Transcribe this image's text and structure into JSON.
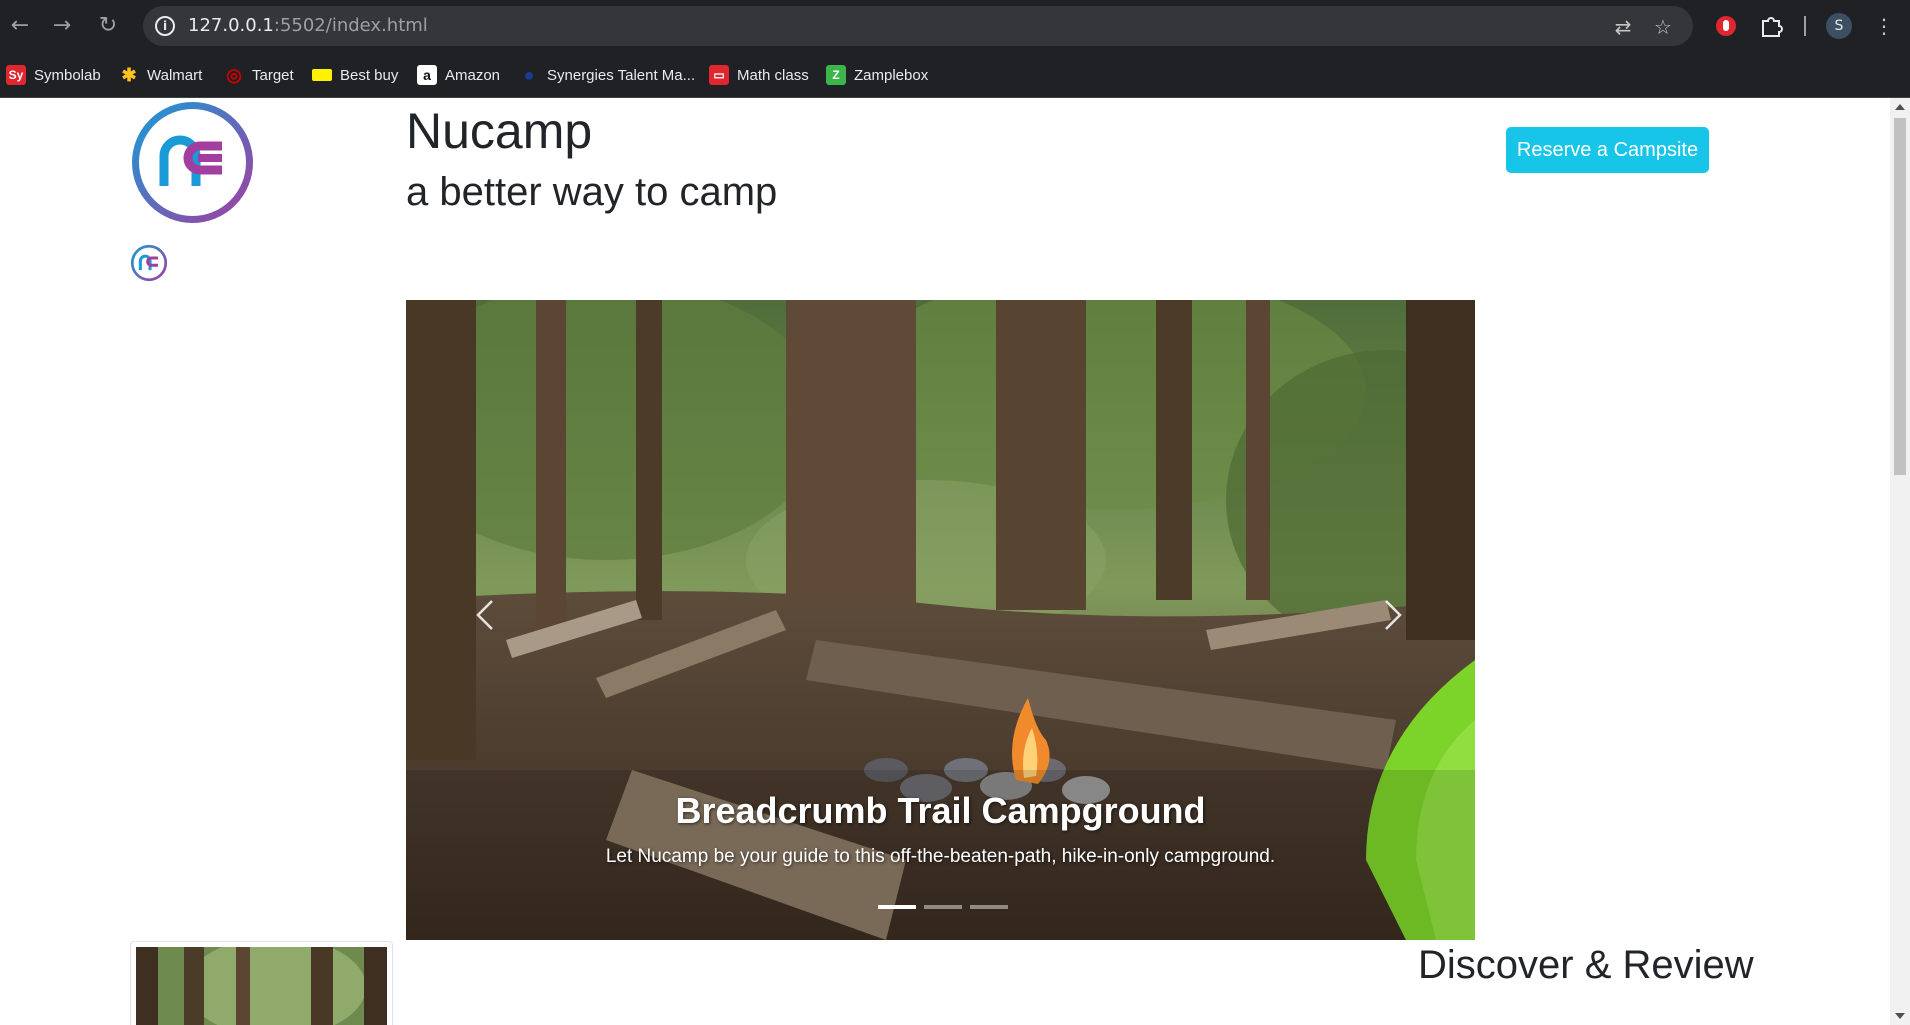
{
  "browser": {
    "url_host": "127.0.0.1",
    "url_rest": ":5502/index.html",
    "profile_initial": "S",
    "bookmarks": [
      {
        "label": "Symbolab",
        "icon": "symbolab-icon",
        "glyph": "Sy",
        "color": "#e0262e"
      },
      {
        "label": "Walmart",
        "icon": "walmart-spark-icon",
        "glyph": "✱",
        "color": "#ffc220"
      },
      {
        "label": "Target",
        "icon": "target-icon",
        "glyph": "◎",
        "color": "#cc0000"
      },
      {
        "label": "Best buy",
        "icon": "bestbuy-tag-icon",
        "glyph": "",
        "color": "#fff200"
      },
      {
        "label": "Amazon",
        "icon": "amazon-icon",
        "glyph": "a",
        "color": "#ffffff"
      },
      {
        "label": "Synergies Talent Ma...",
        "icon": "synergies-icon",
        "glyph": "●",
        "color": "#1a3c8f"
      },
      {
        "label": "Math class",
        "icon": "math-class-icon",
        "glyph": "▭",
        "color": "#e0262e"
      },
      {
        "label": "Zamplebox",
        "icon": "zamplebox-icon",
        "glyph": "Z",
        "color": "#3cb54a"
      }
    ]
  },
  "header": {
    "title": "Nucamp",
    "tagline": "a better way to camp",
    "reserve_button": "Reserve a Campsite"
  },
  "carousel": {
    "caption_title": "Breadcrumb Trail Campground",
    "caption_text": "Let Nucamp be your guide to this off-the-beaten-path, hike-in-only campground.",
    "active_index": 0,
    "slide_count": 3
  },
  "section": {
    "heading": "Discover & Review"
  },
  "colors": {
    "accent": "#17c5e8",
    "logo_blue": "#1a9ad6",
    "logo_purple": "#a13ea0",
    "chrome_bg": "#202124"
  }
}
